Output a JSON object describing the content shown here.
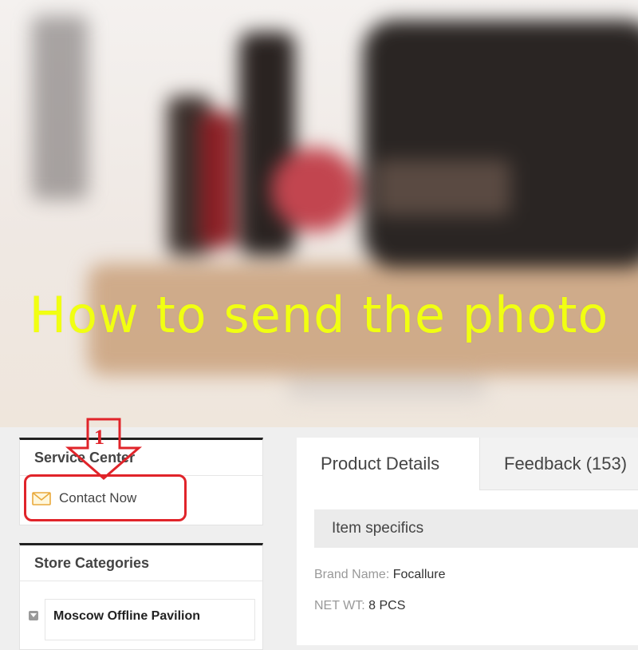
{
  "hero": {
    "caption": "How to send the photo"
  },
  "annotation": {
    "step_number": "1",
    "highlight_color": "#e0242a"
  },
  "sidebar": {
    "service_center": {
      "title": "Service Center",
      "contact_label": "Contact Now",
      "contact_icon": "mail-icon"
    },
    "store_categories": {
      "title": "Store Categories",
      "items": [
        {
          "label": "Moscow Offline Pavilion"
        }
      ]
    }
  },
  "main": {
    "tabs": [
      {
        "label": "Product Details",
        "active": true
      },
      {
        "label": "Feedback (153)",
        "active": false
      }
    ],
    "item_specifics": {
      "title": "Item specifics",
      "rows": [
        {
          "key": "Brand Name:",
          "value": "Focallure"
        },
        {
          "key": "NET WT:",
          "value": "8 PCS"
        }
      ]
    }
  },
  "colors": {
    "caption": "#f1ff12",
    "accent_red": "#e0242a"
  }
}
